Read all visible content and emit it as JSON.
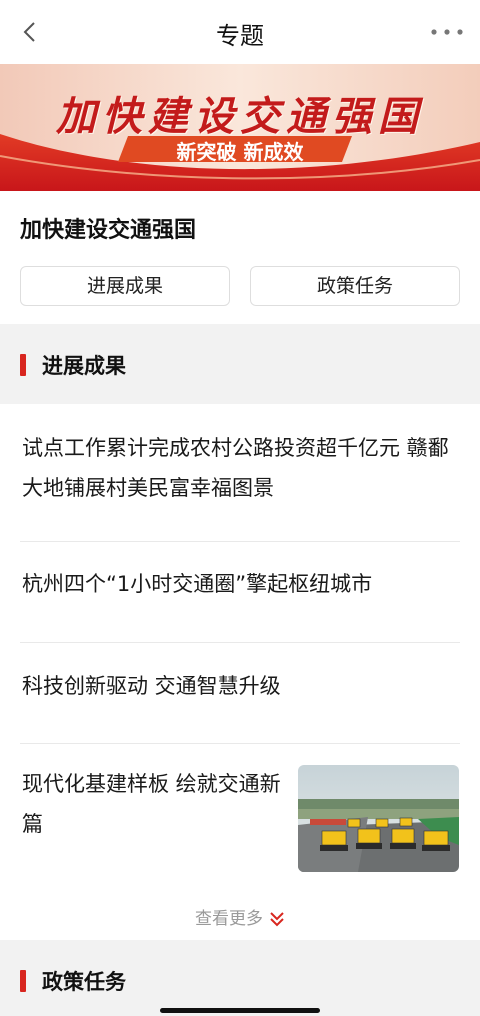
{
  "header": {
    "title": "专题",
    "back_icon": "chevron-left-icon",
    "more_icon": "more-dots-icon"
  },
  "banner": {
    "headline": "加快建设交通强国",
    "subline": "新突破 新成效",
    "colors": {
      "headline": "#c31b1b",
      "ribbon": "#e03a1f"
    }
  },
  "topic": {
    "name": "加快建设交通强国",
    "tabs": [
      "进展成果",
      "政策任务"
    ]
  },
  "sections": {
    "progress": {
      "title": "进展成果",
      "items": [
        "试点工作累计完成农村公路投资超千亿元 赣鄱大地铺展村美民富幸福图景",
        "杭州四个“1小时交通圈”擎起枢纽城市",
        "科技创新驱动  交通智慧升级",
        "现代化基建样板  绘就交通新篇"
      ],
      "see_more": "查看更多"
    },
    "policy": {
      "title": "政策任务"
    }
  },
  "accent_color": "#d8261f"
}
